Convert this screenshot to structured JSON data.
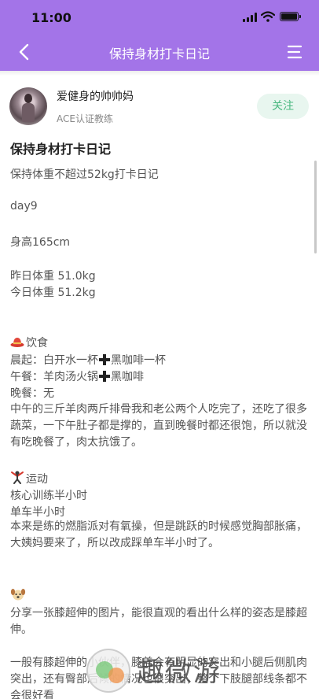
{
  "status_bar": {
    "time": "11:00"
  },
  "nav": {
    "title": "保持身材打卡日记"
  },
  "author": {
    "name": "爱健身的帅帅妈",
    "role": "ACE认证教练",
    "follow_label": "关注"
  },
  "post": {
    "title": "保持身材打卡日记",
    "lines": [
      "保持体重不超过52kg打卡日记",
      "day9",
      "身高165cm",
      "昨日体重  51.0kg",
      "今日体重  51.2kg"
    ],
    "diet": {
      "heading": "饮食",
      "breakfast_a": "晨起：白开水一杯",
      "breakfast_b": "黑咖啡一杯",
      "lunch_a": "午餐：羊肉汤火锅",
      "lunch_b": "黑咖啡",
      "dinner": "晚餐：无",
      "note": "中午的三斤羊肉两斤排骨我和老公两个人吃完了，还吃了很多蔬菜，一下午肚子都是撑的，直到晚餐时都还很饱，所以就没有吃晚餐了，肉太抗饿了。"
    },
    "sport": {
      "heading": "运动",
      "item1": "核心训练半小时",
      "item2": "单车半小时",
      "note": "本来是练的燃脂派对有氧操，但是跳跃的时候感觉胸部胀痛，大姨妈要来了，所以改成踩单车半小时了。"
    },
    "share": {
      "note": "分享一张膝超伸的图片，能很直观的看出什么样的姿态是膝超伸。",
      "more": "一般有膝超伸的小伙伴，膝盖会有明显的突出和小腿后侧肌肉突出，还有臀部后倾的情况也很突出，整个下肢腿部线条都不会很好看"
    }
  },
  "watermark": {
    "text": "趣微游"
  },
  "icons": [
    "back-arrow-icon",
    "menu-icon",
    "signal-icon",
    "wifi-icon",
    "battery-icon",
    "hat-icon",
    "exercise-icon",
    "dog-icon",
    "plus-icon"
  ],
  "colors": {
    "nav_bg": "#a374e8",
    "follow_bg": "#e8f6ef",
    "follow_text": "#4bb981"
  }
}
